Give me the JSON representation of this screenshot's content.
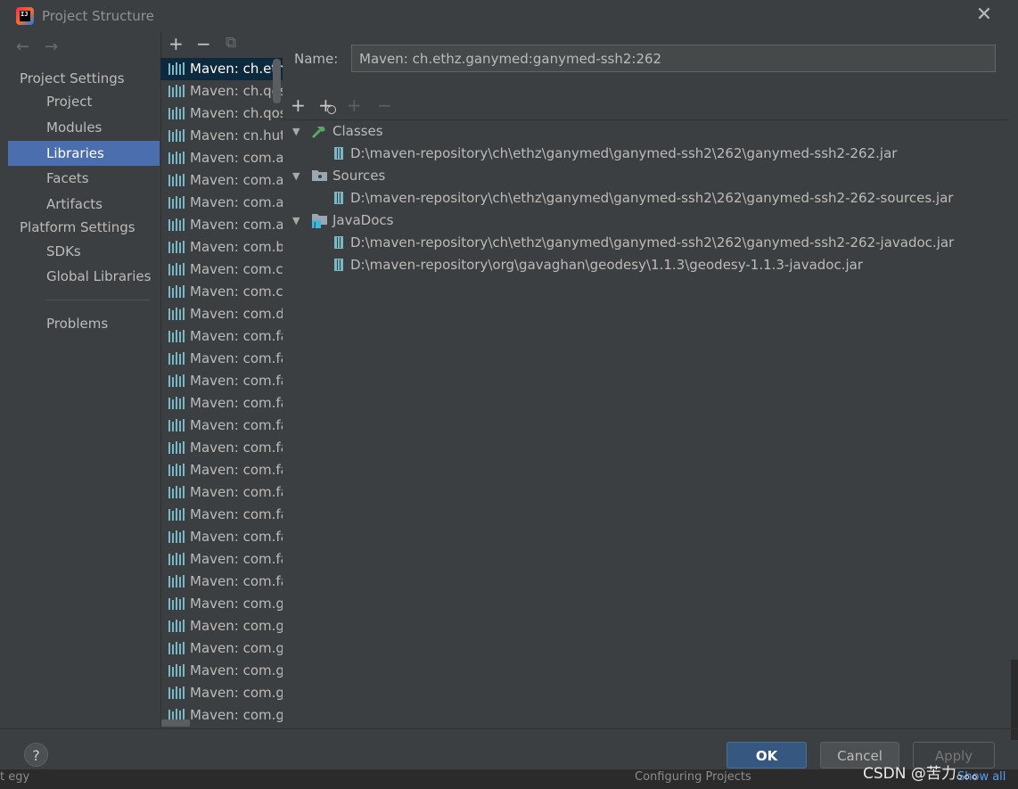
{
  "window": {
    "title": "Project Structure",
    "close_glyph": "✕"
  },
  "nav": {
    "back": "←",
    "forward": "→"
  },
  "sidebar": {
    "project_settings_header": "Project Settings",
    "project_items": [
      {
        "label": "Project"
      },
      {
        "label": "Modules"
      },
      {
        "label": "Libraries",
        "selected": true
      },
      {
        "label": "Facets"
      },
      {
        "label": "Artifacts"
      }
    ],
    "platform_settings_header": "Platform Settings",
    "platform_items": [
      {
        "label": "SDKs"
      },
      {
        "label": "Global Libraries"
      }
    ],
    "problems_label": "Problems"
  },
  "list_toolbar": {
    "add": "+",
    "remove": "−",
    "copy": "⧉"
  },
  "libraries": [
    "Maven: ch.ethz",
    "Maven: ch.qos",
    "Maven: ch.qos",
    "Maven: cn.hutc",
    "Maven: com.al",
    "Maven: com.al",
    "Maven: com.al",
    "Maven: com.au",
    "Maven: com.b",
    "Maven: com.ca",
    "Maven: com.cc",
    "Maven: com.d",
    "Maven: com.fa",
    "Maven: com.fa",
    "Maven: com.fa",
    "Maven: com.fa",
    "Maven: com.fa",
    "Maven: com.fa",
    "Maven: com.fa",
    "Maven: com.fa",
    "Maven: com.fa",
    "Maven: com.fa",
    "Maven: com.fa",
    "Maven: com.fa",
    "Maven: com.g",
    "Maven: com.g",
    "Maven: com.g",
    "Maven: com.g",
    "Maven: com.g",
    "Maven: com.g",
    "Maven: com.g"
  ],
  "detail": {
    "name_label": "Name:",
    "name_value": "Maven: ch.ethz.ganymed:ganymed-ssh2:262",
    "toolbar": {
      "add": "+",
      "add_special": "+",
      "add_disabled": "+",
      "remove": "−"
    },
    "classes_label": "Classes",
    "classes_paths": [
      "D:\\maven-repository\\ch\\ethz\\ganymed\\ganymed-ssh2\\262\\ganymed-ssh2-262.jar"
    ],
    "sources_label": "Sources",
    "sources_paths": [
      "D:\\maven-repository\\ch\\ethz\\ganymed\\ganymed-ssh2\\262\\ganymed-ssh2-262-sources.jar"
    ],
    "javadocs_label": "JavaDocs",
    "javadocs_paths": [
      "D:\\maven-repository\\ch\\ethz\\ganymed\\ganymed-ssh2\\262\\ganymed-ssh2-262-javadoc.jar",
      "D:\\maven-repository\\org\\gavaghan\\geodesy\\1.1.3\\geodesy-1.1.3-javadoc.jar"
    ]
  },
  "buttons": {
    "help": "?",
    "ok": "OK",
    "cancel": "Cancel",
    "apply": "Apply"
  },
  "background": {
    "left_text": "t egy",
    "mid_text": "Configuring Projects",
    "right_text": "Show all"
  },
  "watermark": "CSDN @苦力。。。",
  "colors": {
    "selection": "#4b6eaf",
    "list_selection": "#0d293e",
    "ok_button": "#365880",
    "library_icon": "#79b8c6"
  }
}
